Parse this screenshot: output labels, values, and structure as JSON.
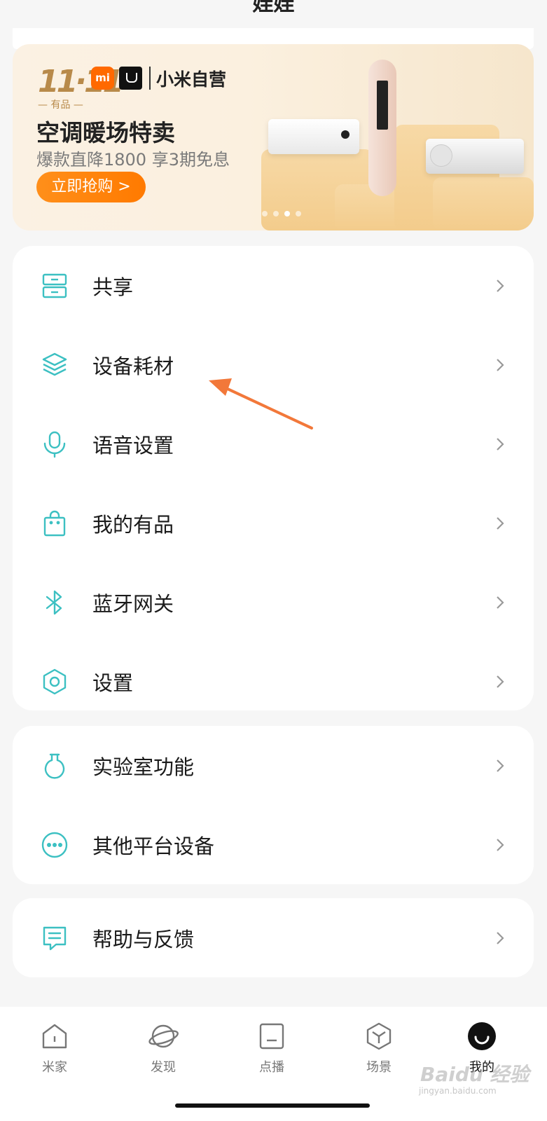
{
  "header": {
    "title": "娃娃"
  },
  "banner": {
    "logo_text": "11·11",
    "youpin_text": "— 有品 —",
    "mi_logo_text": "mi",
    "brand_text": "小米自营",
    "headline": "空调暖场特卖",
    "subline": "爆款直降1800 享3期免息",
    "cta": "立即抢购 >",
    "active_dot": 2,
    "dot_count": 4
  },
  "menu_group1": [
    {
      "label": "共享",
      "icon": "share-drawer-icon"
    },
    {
      "label": "设备耗材",
      "icon": "layers-icon"
    },
    {
      "label": "语音设置",
      "icon": "microphone-icon"
    },
    {
      "label": "我的有品",
      "icon": "shopping-bag-icon"
    },
    {
      "label": "蓝牙网关",
      "icon": "bluetooth-icon"
    },
    {
      "label": "设置",
      "icon": "hexagon-settings-icon"
    }
  ],
  "menu_group2": [
    {
      "label": "实验室功能",
      "icon": "flask-icon"
    },
    {
      "label": "其他平台设备",
      "icon": "more-dots-icon"
    }
  ],
  "menu_group3": [
    {
      "label": "帮助与反馈",
      "icon": "feedback-icon"
    }
  ],
  "tabbar": {
    "items": [
      {
        "label": "米家",
        "icon": "home-icon"
      },
      {
        "label": "发现",
        "icon": "planet-icon"
      },
      {
        "label": "点播",
        "icon": "media-icon"
      },
      {
        "label": "场景",
        "icon": "scene-cube-icon"
      },
      {
        "label": "我的",
        "icon": "profile-icon"
      }
    ],
    "active": "我的"
  },
  "watermark": {
    "text": "Baidu 经验",
    "url": "jingyan.baidu.com"
  },
  "colors": {
    "accent": "#3cc0c2",
    "cta": "#ff7a00",
    "annotation_arrow": "#f2783a"
  }
}
